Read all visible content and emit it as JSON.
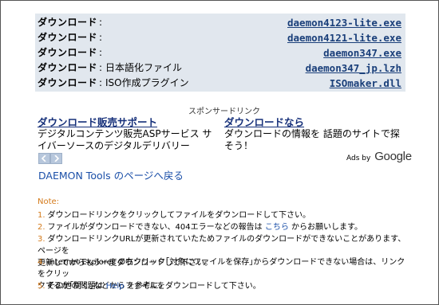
{
  "downloads": [
    {
      "label": "ダウンロード",
      "colon": ":",
      "desc": "",
      "file": "daemon4123-lite.exe"
    },
    {
      "label": "ダウンロード",
      "colon": ":",
      "desc": "",
      "file": "daemon4121-lite.exe"
    },
    {
      "label": "ダウンロード",
      "colon": ":",
      "desc": "",
      "file": "daemon347.exe"
    },
    {
      "label": "ダウンロード",
      "colon": ":",
      "desc": "日本語化ファイル",
      "file": "daemon347_jp.lzh"
    },
    {
      "label": "ダウンロード",
      "colon": ":",
      "desc": "ISO作成プラグイン",
      "file": "ISOmaker.dll"
    }
  ],
  "sponsor_label": "スポンサードリンク",
  "ads": [
    {
      "title": "ダウンロード販売サポート",
      "body": "デジタルコンテンツ販売ASPサービス サイバーソースのデジタルデリバリー"
    },
    {
      "title": "ダウンロードなら",
      "body": "ダウンロードの情報を 話題のサイトで探そう！"
    }
  ],
  "ads_by": "Ads by",
  "google": "Google",
  "back_link": "DAEMON Tools のページへ戻る",
  "note_title": "Note:",
  "notes": {
    "n1": {
      "num": "1.",
      "text": "ダウンロードリンクをクリックしてファイルをダウンロードして下さい。"
    },
    "n2": {
      "num": "2.",
      "pre": "ファイルがダウンロードできない、404エラーなどの報告は",
      "link": "こちら",
      "post": "からお願いします。"
    },
    "n3": {
      "num": "3.",
      "line1": "ダウンロードリンクURLが更新されていたためファイルのダウンロードができないことがあります、ページを",
      "line2": "更新してからもう一度ダウンロードして下さい。"
    },
    "n4": {
      "num": "4.",
      "line1": "Internet Explorer の右クリック｢対象にファイルを保存｣からダウンロードできない場合は、リンクをクリッ",
      "line2": "クするか｢開く｣などからファイルをダウンロードして下さい。"
    },
    "n5": {
      "num": "5.",
      "pre": "その他の問題は",
      "link": "Help",
      "post": "を参考に。"
    }
  },
  "colors": {
    "accent": "#d47a1a",
    "link": "#1b4fa8",
    "table_bg": "#e1e7ee"
  }
}
